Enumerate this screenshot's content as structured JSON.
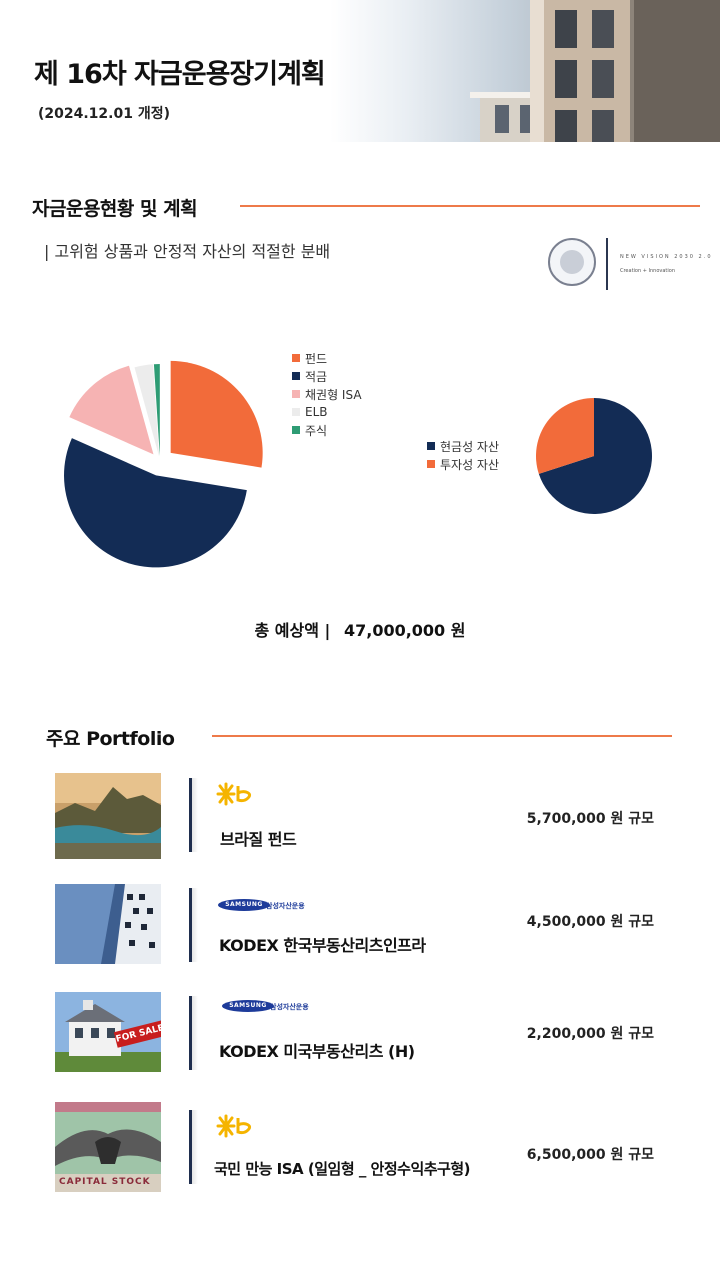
{
  "header": {
    "title": "제 16차 자금운용장기계획",
    "subtitle": "(2024.12.01 개정)"
  },
  "section_status": {
    "title": "자금운용현황 및 계획",
    "tagline": "| 고위험 상품과 안정적 자산의 적절한 분배",
    "logo_text_1": "NEW VISION 2030 2.0",
    "logo_text_2": "Creation + Innovation"
  },
  "chart_data": [
    {
      "type": "pie",
      "categories": [
        "펀드",
        "적금",
        "채권형 ISA",
        "ELB",
        "주식"
      ],
      "values": [
        27.0,
        53.0,
        13.8,
        3.2,
        1.0
      ],
      "colors": [
        "#f26b3a",
        "#132c55",
        "#f6b3b3",
        "#ececec",
        "#2e9c74"
      ],
      "exploded": true,
      "legend_position": "right"
    },
    {
      "type": "pie",
      "categories": [
        "현금성 자산",
        "투자성 자산"
      ],
      "values": [
        70,
        30
      ],
      "colors": [
        "#132c55",
        "#f26b3a"
      ],
      "legend_position": "left"
    }
  ],
  "total": {
    "label": "총 예상액 |",
    "value": "47,000,000 원"
  },
  "portfolio": {
    "title": "주요 Portfolio",
    "items": [
      {
        "name": "브라질 펀드",
        "amount": "5,700,000 원 규모",
        "brand": "kb",
        "thumb": "coastal-city"
      },
      {
        "name": "KODEX 한국부동산리츠인프라",
        "amount": "4,500,000 원 규모",
        "brand": "samsung",
        "thumb": "skyscrapers"
      },
      {
        "name": "KODEX 미국부동산리츠 (H)",
        "amount": "2,200,000 원 규모",
        "brand": "samsung",
        "thumb": "house-for-sale"
      },
      {
        "name": "국민 만능 ISA (일임형 _ 안정수익추구형)",
        "amount": "6,500,000 원 규모",
        "brand": "kb",
        "thumb": "eagle-certificate"
      }
    ],
    "samsung_logo": "SAMSUNG",
    "samsung_sub": "삼성자산운용",
    "for_sale_text": "FOR SALE",
    "certificate_text": "CAPITAL STOCK"
  }
}
